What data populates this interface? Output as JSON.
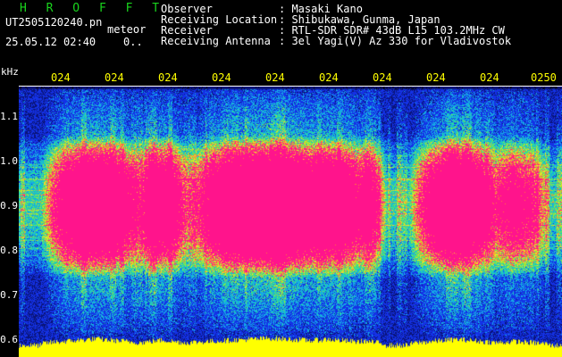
{
  "header": {
    "title": "H R O F F T",
    "file_name": "UT2505120240.pn",
    "mode": "meteor",
    "datetime": "25.05.12 02:40",
    "indicator": "0.."
  },
  "info": {
    "observer_label": "Observer",
    "observer_value": ": Masaki Kano",
    "location_label": "Receiving Location",
    "location_value": ": Shibukawa, Gunma, Japan",
    "receiver_label": "Receiver",
    "receiver_value": ": RTL-SDR SDR# 43dB L15 103.2MHz CW",
    "antenna_label": "Receiving Antenna",
    "antenna_value": ": 3el Yagi(V) Az 330 for Vladivostok"
  },
  "axes": {
    "y_unit": "kHz",
    "y_ticks": [
      "1.1",
      "1.0",
      "0.9",
      "0.8",
      "0.7",
      "0.6"
    ],
    "x_ticks": [
      "024",
      "024",
      "024",
      "024",
      "024",
      "024",
      "024",
      "024",
      "024",
      "0250"
    ]
  },
  "colors": {
    "background": "#000000",
    "noise_blue": "#1a2fe0",
    "meteor_pink": "#ff1a8c",
    "power_yellow": "#ffff00",
    "title_green": "#19d41d"
  }
}
